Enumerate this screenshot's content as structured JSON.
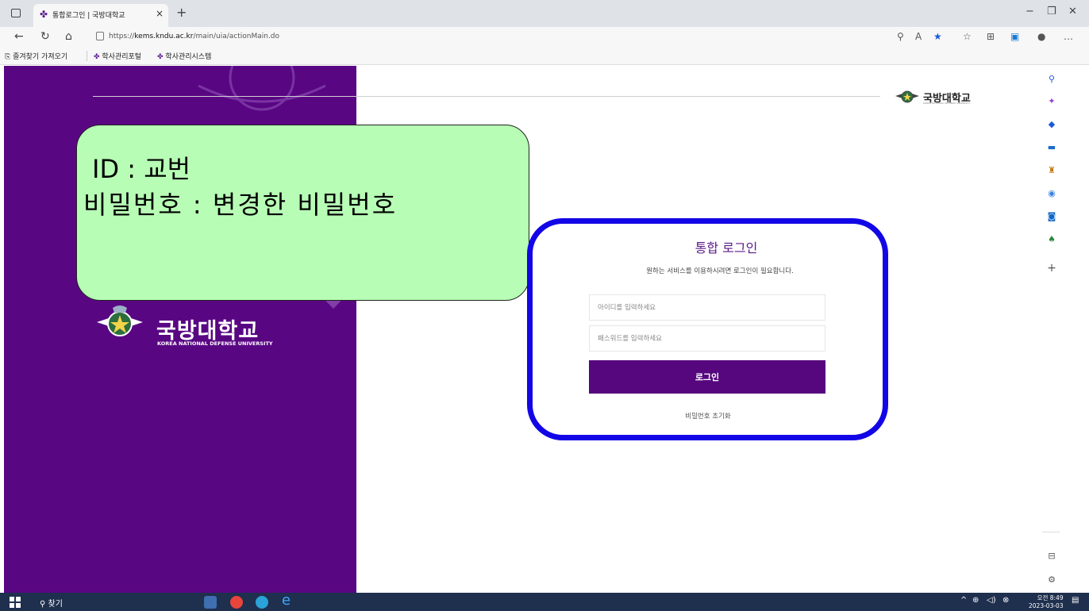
{
  "browser": {
    "tab_title": "통합로그인 | 국방대학교",
    "tab_close": "×",
    "new_tab": "+",
    "url_prefix": "https://",
    "url_host": "kems.kndu.ac.kr",
    "url_path": "/main/uia/actionMain.do",
    "bookmarks": [
      {
        "label": "즐겨찾기 가져오기"
      },
      {
        "label": "학사관리포털"
      },
      {
        "label": "학사관리시스템"
      }
    ]
  },
  "page": {
    "university_name": "국방대학교",
    "university_english": "KOREA NATIONAL DEFENSE UNIVERSITY",
    "right_logo_text": "국방대학교",
    "right_logo_sub": "KOREA NATIONAL DEFENSE UNIVERSITY",
    "login_title": "통합 로그인",
    "login_desc": "원하는 서비스를 이용하시려면 로그인이 필요합니다.",
    "id_placeholder": "아이디를 입력하세요",
    "pw_placeholder": "패스워드를 입력하세요",
    "login_button": "로그인",
    "reset_link": "비밀번호 초기화"
  },
  "callout": {
    "line1": "ID : 교번",
    "line2": "비밀번호 : 변경한 비밀번호"
  },
  "taskbar": {
    "search_label": "찾기",
    "time": "오전 8:49",
    "date": "2023-03-03"
  },
  "colors": {
    "brand_purple": "#590683",
    "callout_green": "#b7fdb5",
    "highlight_blue": "#1306e6"
  }
}
